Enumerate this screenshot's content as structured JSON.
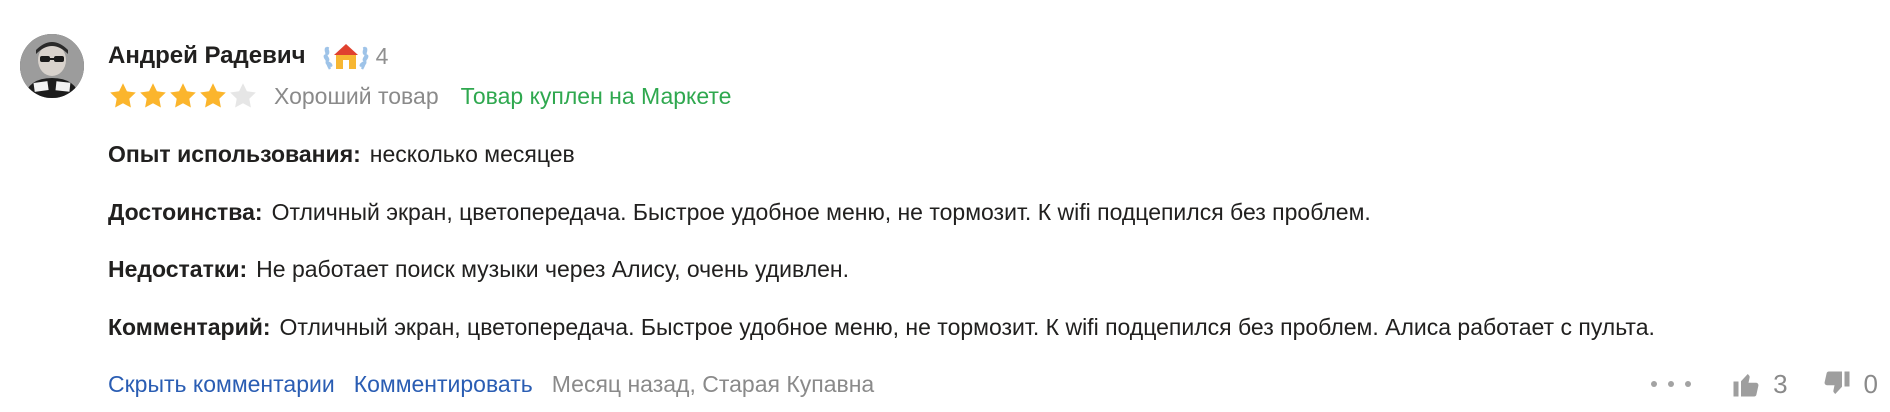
{
  "author": {
    "name": "Андрей Радевич",
    "badge_icon": "house-laurel-badge-icon",
    "badge_count": "4"
  },
  "rating": {
    "value": 4,
    "max": 5,
    "star_color": "#fbb52c",
    "empty_star_color": "#e6e6e6",
    "verdict": "Хороший товар",
    "bought_label": "Товар куплен на Маркете",
    "bought_color": "#2fa84f"
  },
  "fields": {
    "usage": {
      "label": "Опыт использования:",
      "value": "несколько месяцев"
    },
    "pros": {
      "label": "Достоинства:",
      "value": "Отличный экран, цветопередача. Быстрое удобное меню, не тормозит. К wifi подцепился без проблем."
    },
    "cons": {
      "label": "Недостатки:",
      "value": "Не работает поиск музыки через Алису, очень удивлен."
    },
    "comment": {
      "label": "Комментарий:",
      "value": "Отличный экран, цветопередача. Быстрое удобное меню, не тормозит. К wifi подцепился без проблем. Алиса работает с пульта."
    }
  },
  "footer": {
    "hide_comments": "Скрыть комментарии",
    "comment": "Комментировать",
    "meta": "Месяц назад, Старая Купавна",
    "link_color": "#2a5db3"
  },
  "votes": {
    "likes": "3",
    "dislikes": "0"
  }
}
